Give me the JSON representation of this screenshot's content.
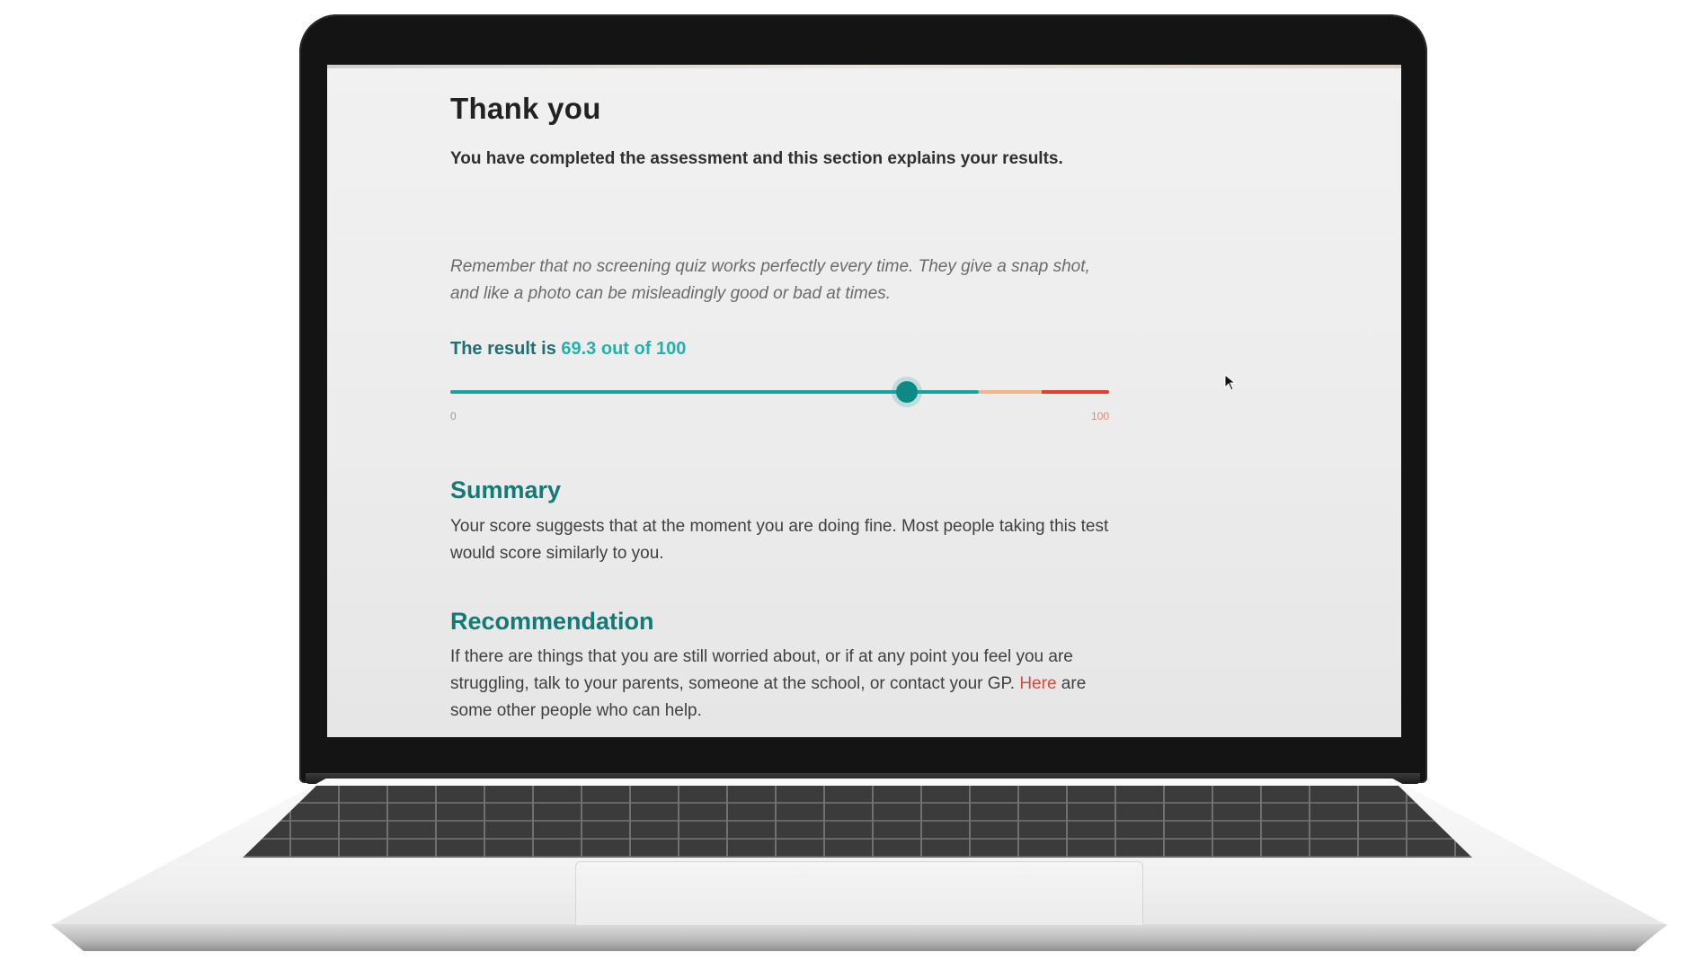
{
  "page": {
    "title": "Thank you",
    "intro": "You have completed the assessment and this section explains your results.",
    "note": "Remember that no screening quiz works perfectly every time. They give a snap shot, and like a photo can be misleadingly good or bad at times."
  },
  "result": {
    "prefix": "The result is ",
    "score_text": "69.3 out of 100",
    "score": 69.3,
    "max": 100
  },
  "slider": {
    "min_label": "0",
    "max_label": "100",
    "colors": {
      "normal": "#17a2a0",
      "moderate": "#f2b48a",
      "high": "#e0402e",
      "thumb": "#0e8a84"
    }
  },
  "summary": {
    "heading": "Summary",
    "text": "Your score suggests that at the moment you are doing fine. Most people taking this test would score similarly to you."
  },
  "recommendation": {
    "heading": "Recommendation",
    "text_before": "If there are things that you are still worried about, or if at any point you feel you are struggling, talk to your parents, someone at the school, or contact your GP. ",
    "link_text": "Here",
    "text_after": " are some other people who can help."
  },
  "theme": {
    "accent": "#137a76",
    "link": "#d84a3c"
  },
  "icons": {
    "cursor": "mouse-pointer-icon"
  }
}
